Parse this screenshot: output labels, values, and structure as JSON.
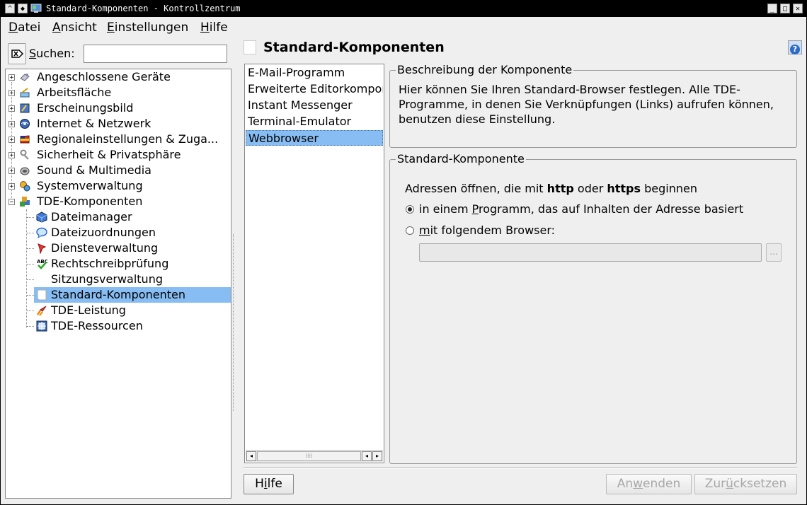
{
  "window": {
    "title": "Standard-Komponenten - Kontrollzentrum",
    "buttons": [
      "^",
      "◆",
      "_",
      "□",
      "✕"
    ]
  },
  "menubar": {
    "items": [
      {
        "underline": "D",
        "rest": "atei"
      },
      {
        "underline": "A",
        "rest": "nsicht"
      },
      {
        "underline": "E",
        "rest": "instellungen"
      },
      {
        "underline": "H",
        "rest": "ilfe"
      }
    ]
  },
  "search": {
    "label_underline": "S",
    "label_rest": "uchen:",
    "value": "",
    "placeholder": ""
  },
  "tree": {
    "items": [
      {
        "label": "Angeschlossene Geräte",
        "icon": "devices-icon",
        "expander": "+"
      },
      {
        "label": "Arbeitsfläche",
        "icon": "desktop-icon",
        "expander": "+"
      },
      {
        "label": "Erscheinungsbild",
        "icon": "appearance-icon",
        "expander": "+"
      },
      {
        "label": "Internet & Netzwerk",
        "icon": "network-icon",
        "expander": "+"
      },
      {
        "label": "Regionaleinstellungen & Zuga...",
        "icon": "regional-icon",
        "expander": "+"
      },
      {
        "label": "Sicherheit & Privatsphäre",
        "icon": "security-icon",
        "expander": "+"
      },
      {
        "label": "Sound & Multimedia",
        "icon": "sound-icon",
        "expander": "+"
      },
      {
        "label": "Systemverwaltung",
        "icon": "system-icon",
        "expander": "+"
      },
      {
        "label": "TDE-Komponenten",
        "icon": "tde-components-icon",
        "expander": "−"
      }
    ],
    "children": [
      {
        "label": "Dateimanager",
        "icon": "file-manager-icon"
      },
      {
        "label": "Dateizuordnungen",
        "icon": "file-associations-icon"
      },
      {
        "label": "Diensteverwaltung",
        "icon": "services-icon"
      },
      {
        "label": "Rechtschreibprüfung",
        "icon": "spellcheck-icon"
      },
      {
        "label": "Sitzungsverwaltung",
        "icon": ""
      },
      {
        "label": "Standard-Komponenten",
        "icon": "page-icon",
        "selected": true
      },
      {
        "label": "TDE-Leistung",
        "icon": "performance-icon"
      },
      {
        "label": "TDE-Ressourcen",
        "icon": "resources-icon"
      }
    ]
  },
  "page": {
    "title": "Standard-Komponenten",
    "help_icon": "?"
  },
  "component_list": {
    "items": [
      "E-Mail-Programm",
      "Erweiterte Editorkomponente",
      "Instant Messenger",
      "Terminal-Emulator",
      "Webbrowser"
    ],
    "selected_index": 4,
    "scroll_left": "◂",
    "scroll_right": "▸",
    "scroll_left2": "◂",
    "thumb_grip": "⁞⁞⁞⁞"
  },
  "description": {
    "title": "Beschreibung der Komponente",
    "text": "Hier können Sie Ihren Standard-Browser festlegen. Alle TDE-Programme, in denen Sie Verknüpfungen (Links) aufrufen können, benutzen diese Einstellung."
  },
  "component": {
    "title": "Standard-Komponente",
    "intro_pre": "Adressen öffnen, die mit ",
    "intro_b1": "http",
    "intro_mid": " oder ",
    "intro_b2": "https",
    "intro_post": " beginnen",
    "option1_pre": "in einem ",
    "option1_u": "P",
    "option1_post": "rogramm, das auf Inhalten der Adresse basiert",
    "option2_u": "m",
    "option2_post": "it folgendem Browser:",
    "selected_option": 1,
    "browser_value": "",
    "browse_label": "..."
  },
  "footer": {
    "help_pre": "H",
    "help_u": "i",
    "help_post": "lfe",
    "apply_pre": "An",
    "apply_u": "w",
    "apply_post": "enden",
    "reset_pre": "Zur",
    "reset_u": "ü",
    "reset_post": "cksetzen"
  },
  "colors": {
    "selection": "#87bdf3",
    "titlebar": "#000000",
    "background": "#efefef"
  }
}
